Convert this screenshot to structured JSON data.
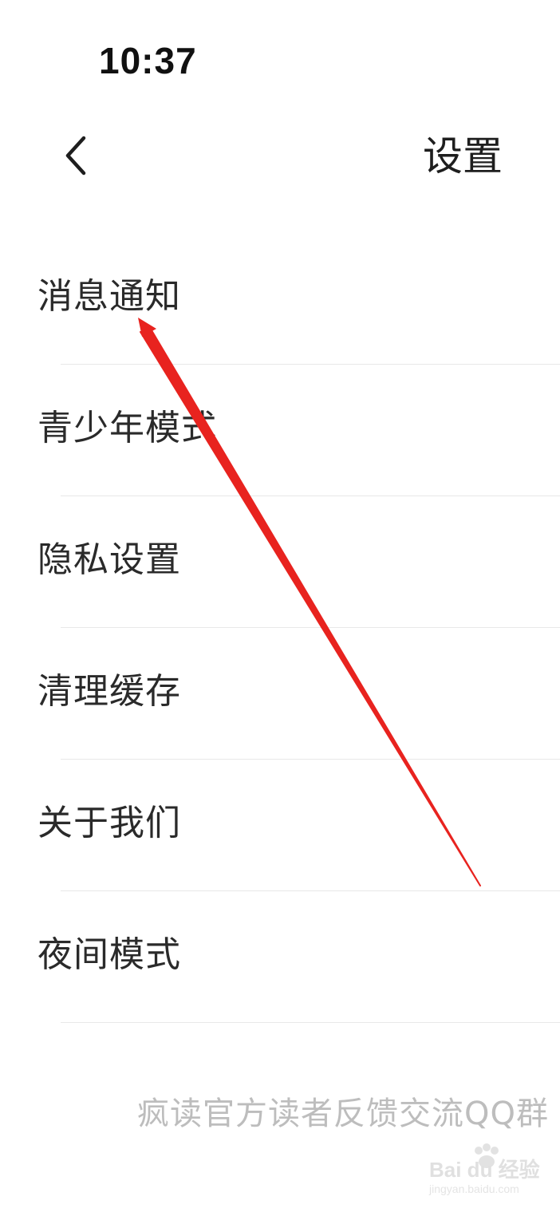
{
  "status_bar": {
    "time": "10:37"
  },
  "nav": {
    "back_icon": "chevron-left-icon",
    "title": "设置"
  },
  "menu": {
    "items": [
      {
        "label": "消息通知"
      },
      {
        "label": "青少年模式"
      },
      {
        "label": "隐私设置"
      },
      {
        "label": "清理缓存"
      },
      {
        "label": "关于我们"
      },
      {
        "label": "夜间模式"
      }
    ]
  },
  "footer": {
    "text": "疯读官方读者反馈交流QQ群"
  },
  "annotation": {
    "color": "#e8231f"
  },
  "watermark": {
    "brand": "Bai du 经验",
    "url": "jingyan.baidu.com"
  }
}
